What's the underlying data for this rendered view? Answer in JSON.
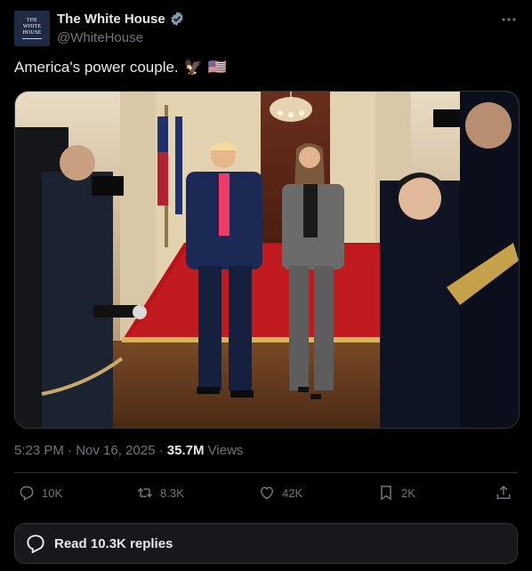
{
  "header": {
    "display_name": "The White House",
    "handle": "@WhiteHouse",
    "avatar_line1": "THE",
    "avatar_line2": "WHITE",
    "avatar_line3": "HOUSE"
  },
  "tweet": {
    "text": "America's power couple.",
    "emoji_1": "🦅",
    "emoji_2": "🇺🇸"
  },
  "meta": {
    "time": "5:23 PM",
    "separator": " · ",
    "date": "Nov 16, 2025",
    "separator2": " · ",
    "views_count": "35.7M",
    "views_label": " Views"
  },
  "actions": {
    "replies": "10K",
    "reposts": "8.3K",
    "likes": "42K",
    "bookmarks": "2K"
  },
  "read_replies": "Read 10.3K replies",
  "icons": {
    "verified": "verified-badge-icon",
    "more": "more-horizontal-icon",
    "reply": "reply-icon",
    "repost": "repost-icon",
    "like": "heart-icon",
    "bookmark": "bookmark-icon",
    "share": "share-icon"
  },
  "colors": {
    "background": "#000000",
    "text": "#e7e9ea",
    "secondary": "#71767b",
    "border": "#2f3336",
    "verified": "#829aab"
  }
}
